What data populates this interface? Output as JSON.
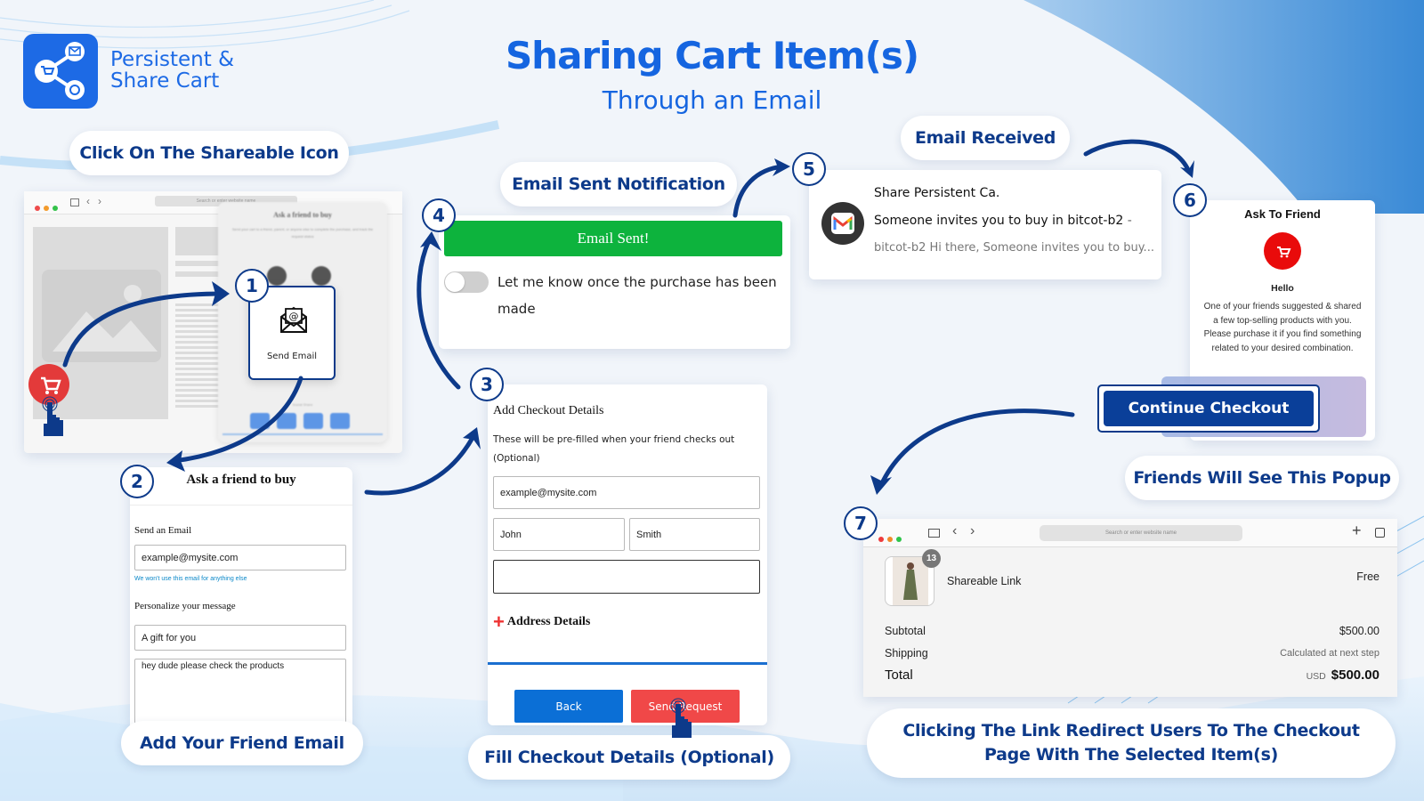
{
  "brand": {
    "name_line1": "Persistent &",
    "name_line2": "Share Cart",
    "logo_icon": "share-cart-icon"
  },
  "header": {
    "title": "Sharing Cart Item(s)",
    "subtitle": "Through an Email"
  },
  "colors": {
    "brand_blue": "#1565e0",
    "dark_navy": "#0d3a8a",
    "success_green": "#0db33d",
    "danger_red": "#f04848",
    "link_blue": "#0b6fd6"
  },
  "captions": {
    "step1": "Click On The Shareable Icon",
    "step2": "Add Your Friend Email",
    "step3": "Fill Checkout Details (Optional)",
    "step4": "Email Sent Notification",
    "step5": "Email Received",
    "step6": "Friends Will See This Popup",
    "step7_line1": "Clicking The Link Redirect Users To The Checkout",
    "step7_line2": "Page With The Selected Item(s)"
  },
  "steps": [
    "1",
    "2",
    "3",
    "4",
    "5",
    "6",
    "7"
  ],
  "step1_browser": {
    "address_placeholder": "Search or enter website name",
    "popup_title": "Ask a friend to buy",
    "popup_desc": "Send your cart to a friend, parent, or anyone else to complete the purchase, and track the request status",
    "send_email_label": "Send Email",
    "send_email_icon": "email-at-icon",
    "social_share_label": "Social Share",
    "social_icons": [
      "facebook-icon",
      "messenger-icon",
      "twitter-icon",
      "whatsapp-icon"
    ]
  },
  "step2_form": {
    "title": "Ask a friend to buy",
    "send_email_label": "Send an Email",
    "email_value": "example@mysite.com",
    "email_hint": "We won't use this email for anything else",
    "personalize_label": "Personalize your message",
    "subject_value": "A gift for you",
    "message_value": "hey dude please check the products"
  },
  "step3_form": {
    "title": "Add Checkout Details",
    "desc_line1": "These will be pre-filled when your friend checks out",
    "desc_line2": "(Optional)",
    "email_value": "example@mysite.com",
    "first_name_value": "John",
    "last_name_value": "Smith",
    "extra_value": "",
    "address_label": "Address Details",
    "back_label": "Back",
    "send_request_label": "Send Request"
  },
  "step4_notification": {
    "banner": "Email Sent!",
    "toggle_label": "Let me know once the purchase has been made",
    "toggle_on": false
  },
  "step5_email": {
    "sender": "Share Persistent Ca.",
    "subject": "Someone invites you to buy in bitcot-b2",
    "subject_suffix": " -",
    "preview": "bitcot-b2 Hi there, Someone invites you to buy..."
  },
  "step6_popup": {
    "title": "Ask To Friend",
    "greeting": "Hello",
    "body": "One of your friends suggested & shared a few top-selling products with you. Please purchase it if you find something related to your desired combination.",
    "cta": "Continue Checkout"
  },
  "step7_checkout": {
    "address_placeholder": "Search or enter website name",
    "item_name": "Shareable Link",
    "item_qty": "13",
    "item_price": "Free",
    "subtotal_label": "Subtotal",
    "subtotal_value": "$500.00",
    "shipping_label": "Shipping",
    "shipping_value": "Calculated at next step",
    "total_label": "Total",
    "currency": "USD",
    "total_value": "$500.00"
  }
}
